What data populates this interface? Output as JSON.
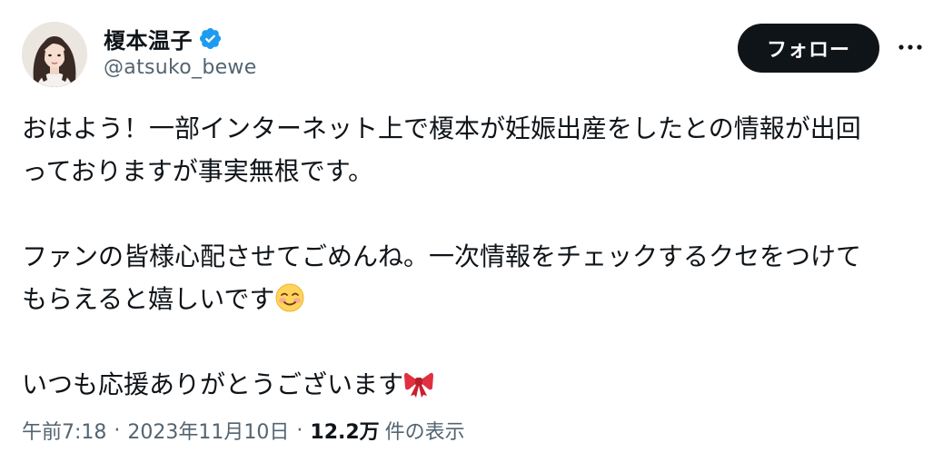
{
  "user": {
    "display_name": "榎本温子",
    "handle": "@atsuko_bewe",
    "verified": true,
    "verified_color": "#1d9bf0"
  },
  "actions": {
    "follow_label": "フォロー",
    "more_icon": "more-dots-icon"
  },
  "tweet": {
    "line1": "おはよう！一部インターネット上で榎本が妊娠出産をしたとの情報が出回",
    "line2": "っておりますが事実無根です。",
    "line3": "ファンの皆様心配させてごめんね。一次情報をチェックするクセをつけて",
    "line4": "もらえると嬉しいです",
    "line4_emoji": "smiling-face-with-blush-emoji",
    "line5": "いつも応援ありがとうございます",
    "line5_emoji": "ribbon-emoji"
  },
  "meta": {
    "time": "午前7:18",
    "separator": "·",
    "date": "2023年11月10日",
    "views_count": "12.2万",
    "views_label": "件の表示"
  },
  "colors": {
    "text": "#0f1419",
    "secondary": "#536471",
    "follow_bg": "#0f1419",
    "follow_text": "#ffffff"
  }
}
